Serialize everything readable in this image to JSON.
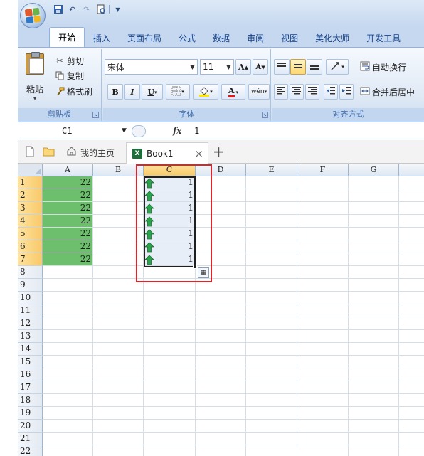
{
  "ribbon": {
    "tabs": [
      "开始",
      "插入",
      "页面布局",
      "公式",
      "数据",
      "审阅",
      "视图",
      "美化大师",
      "开发工具"
    ],
    "active_tab": "开始",
    "clipboard": {
      "paste": "粘贴",
      "cut": "剪切",
      "copy": "复制",
      "format_painter": "格式刷",
      "group_label": "剪贴板"
    },
    "font": {
      "name": "宋体",
      "size": "11",
      "group_label": "字体",
      "bold": "B",
      "italic": "I",
      "underline": "U",
      "grow": "A",
      "shrink": "A",
      "phonetic": "wén",
      "font_color": "A"
    },
    "alignment": {
      "wrap_text": "自动换行",
      "merge_center": "合并后居中",
      "group_label": "对齐方式"
    }
  },
  "formula_bar": {
    "name_box": "C1",
    "fx": "fx",
    "value": "1"
  },
  "doc_tabs": {
    "home": "我的主页",
    "book": "Book1",
    "close": "×",
    "add": "+"
  },
  "sheet": {
    "columns": [
      "A",
      "B",
      "C",
      "D",
      "E",
      "F",
      "G"
    ],
    "selected_column": "C",
    "rows": [
      "1",
      "2",
      "3",
      "4",
      "5",
      "6",
      "7",
      "8",
      "9",
      "10",
      "11",
      "12",
      "13",
      "14",
      "15",
      "16",
      "17",
      "18",
      "19",
      "20",
      "21",
      "22"
    ],
    "selected_rows": [
      "1",
      "2",
      "3",
      "4",
      "5",
      "6",
      "7"
    ],
    "col_a_values": [
      "22",
      "22",
      "22",
      "22",
      "22",
      "22",
      "22"
    ],
    "col_c_values": [
      "1",
      "1",
      "1",
      "1",
      "1",
      "1",
      "1"
    ],
    "colors": {
      "green_fill": "#6dbf6e",
      "highlight_box": "#d8262b",
      "up_arrow": "#2aa44a",
      "selected_header": "#f8c968"
    }
  }
}
